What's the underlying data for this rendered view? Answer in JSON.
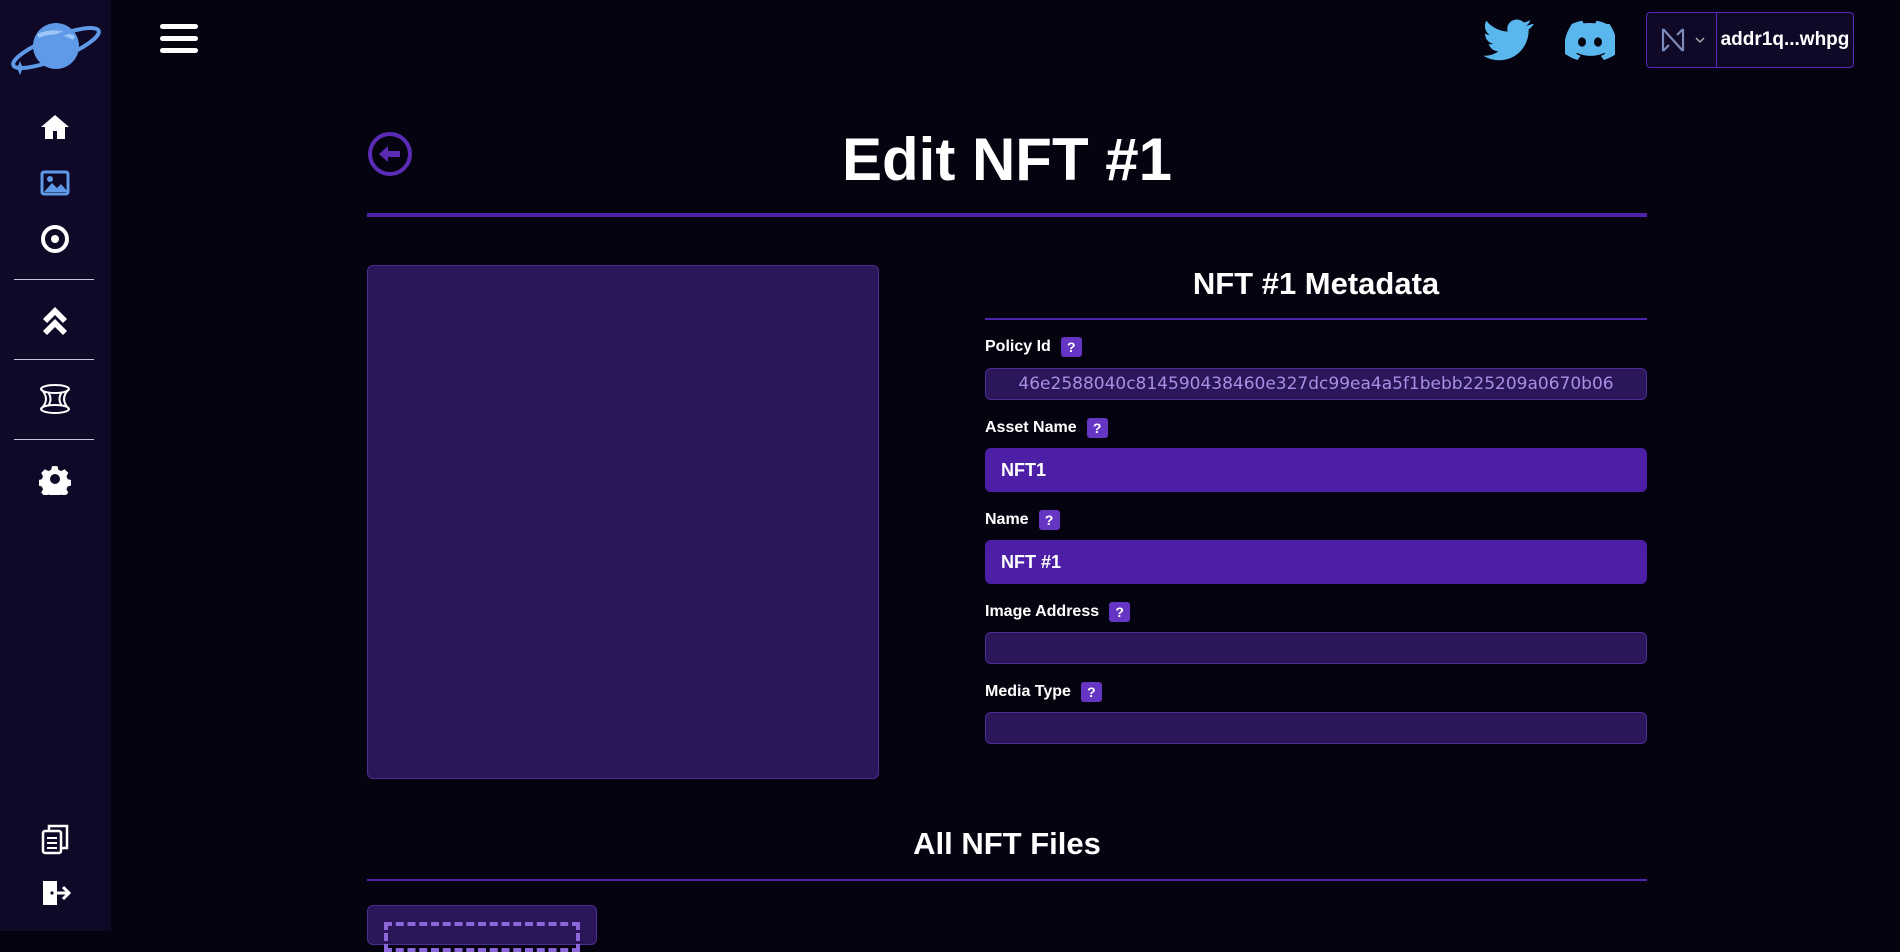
{
  "header": {
    "wallet_address": "addr1q...whpg"
  },
  "page": {
    "title": "Edit NFT #1"
  },
  "metadata": {
    "title": "NFT #1 Metadata",
    "fields": [
      {
        "label": "Policy Id",
        "value": "46e2588040c814590438460e327dc99ea4a5f1bebb225209a0670b06"
      },
      {
        "label": "Asset Name",
        "value": "NFT1"
      },
      {
        "label": "Name",
        "value": "NFT #1"
      },
      {
        "label": "Image Address",
        "value": ""
      },
      {
        "label": "Media Type",
        "value": ""
      }
    ],
    "help_glyph": "?"
  },
  "files": {
    "title": "All NFT Files"
  },
  "icons": {
    "sidebar": [
      "home-icon",
      "image-icon",
      "circle-target-icon",
      "chevrons-up-icon",
      "wormhole-icon",
      "gear-icon",
      "docs-icon",
      "logout-icon"
    ],
    "social": [
      "twitter-icon",
      "discord-icon"
    ]
  },
  "colors": {
    "accent": "#4c23a8",
    "panel": "#2b1659",
    "input_active": "#4c1fa6",
    "social": "#5ab7ee"
  }
}
